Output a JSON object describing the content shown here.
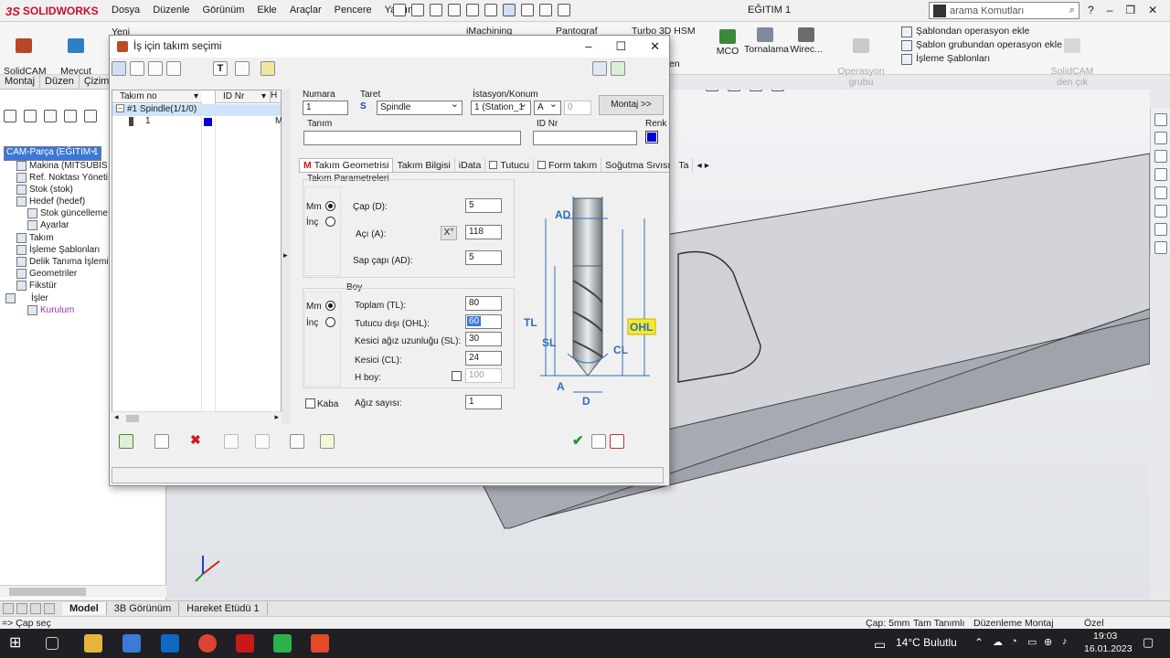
{
  "app": {
    "brand_prefix": "3S",
    "brand": "SOLIDWORKS",
    "menus": [
      "Dosya",
      "Düzenle",
      "Görünüm",
      "Ekle",
      "Araçlar",
      "Pencere",
      "Yardım"
    ],
    "document_title": "EĞITIM 1",
    "search_placeholder": "arama Komutları"
  },
  "ribbon": {
    "solidcam_about": "SolidCAM\nhakkında",
    "current_cam_parts": "Mevcut\nCAM-Parçaları",
    "new_label": "Yeni",
    "imachining": "iMachining",
    "pantograf": "Pantograf",
    "turbo": "Turbo 3D HSM",
    "mco": "MCO",
    "tornalama": "Tornalama",
    "wire": "Wirec...",
    "op_group_sync": "Operasyon grubu\nsenkronizasyonu",
    "template_ops": [
      "Şablondan operasyon ekle",
      "Şablon grubundan operasyon ekle",
      "İşleme Şablonları"
    ],
    "solidcam_exit": "SolidCAM\nden çık",
    "en_tab": "en"
  },
  "cm_tabs": [
    "Montaj",
    "Düzen",
    "Çizim"
  ],
  "tree": {
    "root": "CAM-Parça (EĞITIM 1",
    "items": [
      "Makina (MITSUBIS",
      "Ref. Noktası Yöneti",
      "Stok (stok)",
      "Hedef (hedef)",
      "Stok güncelleme",
      "Ayarlar",
      "Takım",
      "İşleme Şablonları",
      "Delik Tanıma İşlemi (H",
      "Geometriler",
      "Fikstür",
      "İşler",
      "Kurulum"
    ]
  },
  "dialog": {
    "title": "İş için takım seçimi",
    "list": {
      "col_tool_no": "Takım no",
      "col_id": "ID Nr",
      "col_h": "H",
      "spindle_row": "#1 Spindle(1/1/0)",
      "tool_row_no": "1",
      "tool_row_m": "M",
      "tool_color": "#0000d8"
    },
    "fields": {
      "numara_label": "Numara",
      "numara_value": "1",
      "taret_label": "Taret",
      "taret_s": "S",
      "taret_value": "Spindle",
      "istasyon_label": "İstasyon/Konum",
      "istasyon_value": "1 (Station_1",
      "istasyon_pos": "A",
      "istasyon_extra": "0",
      "montaj_button": "Montaj >>",
      "tanim_label": "Tanım",
      "tanim_value": "",
      "idnr_label": "ID Nr",
      "idnr_value": "",
      "renk_label": "Renk",
      "renk_color": "#0000d8"
    },
    "tabs": [
      {
        "icon": "M",
        "label": "Takım Geometrisi"
      },
      {
        "icon": "",
        "label": "Takım Bilgisi"
      },
      {
        "icon": "",
        "label": "iData"
      },
      {
        "icon": "chk",
        "label": "Tutucu"
      },
      {
        "icon": "chk",
        "label": "Form takım"
      },
      {
        "icon": "",
        "label": "Soğutma Sıvısı"
      },
      {
        "icon": "",
        "label": "Ta"
      }
    ],
    "params": {
      "group_title": "Takım Parametreleri",
      "mm": "Mm",
      "inc": "İnç",
      "cap_label": "Çap (D):",
      "cap_value": "5",
      "aci_label": "Açı (A):",
      "aci_btn": "X°",
      "aci_value": "118",
      "sap_label": "Sap çapı (AD):",
      "sap_value": "5"
    },
    "boy": {
      "group_title": "Boy",
      "mm": "Mm",
      "inc": "İnç",
      "toplam_label": "Toplam (TL):",
      "toplam_value": "80",
      "tutucu_label": "Tutucu dışı (OHL):",
      "tutucu_value": "60",
      "kesici_agiz_label": "Kesici ağız uzunluğu (SL):",
      "kesici_agiz_value": "30",
      "kesici_label": "Kesici (CL):",
      "kesici_value": "24",
      "hboy_label": "H boy:",
      "hboy_value": "100"
    },
    "kaba": "Kaba",
    "agiz_label": "Ağız sayısı:",
    "agiz_value": "1",
    "diagram_labels": {
      "ad": "AD",
      "tl": "TL",
      "sl": "SL",
      "cl": "CL",
      "ohl": "OHL",
      "a": "A",
      "d": "D"
    }
  },
  "bottom_tabs": [
    "Model",
    "3B Görünüm",
    "Hareket Etüdü 1"
  ],
  "status": {
    "left": "=> Çap seç",
    "cap": "Çap: 5mm",
    "tanimli": "Tam Tanımlı",
    "mode": "Düzenleme Montaj",
    "ozel": "Özel"
  },
  "taskbar": {
    "weather": "14°C Bulutlu",
    "time": "19:03",
    "date": "16.01.2023"
  }
}
